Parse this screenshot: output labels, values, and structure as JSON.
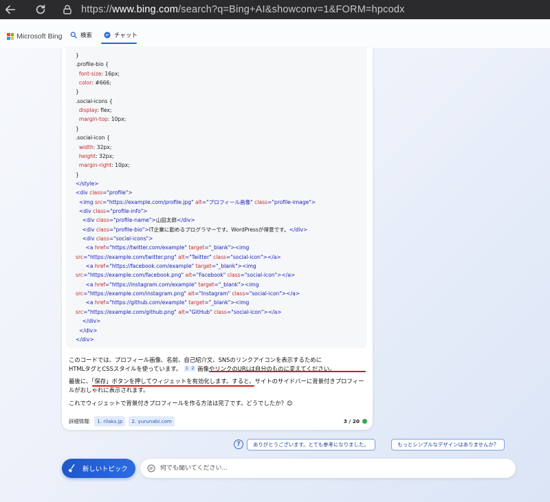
{
  "browser": {
    "url_scheme": "https://",
    "url_host": "www.bing.com",
    "url_path": "/search?q=Bing+AI&showconv=1&FORM=hpcodx"
  },
  "header": {
    "logo_text": "Microsoft Bing",
    "tab_search": "検索",
    "tab_chat": "チャット"
  },
  "code_lines": [
    [
      {
        "t": "}",
        "c": "t-txt"
      }
    ],
    [
      {
        "t": ".profile-bio {",
        "c": "t-txt"
      }
    ],
    [
      {
        "t": "  font-size",
        "c": "t-prop"
      },
      {
        "t": ": 16px;",
        "c": "t-txt"
      }
    ],
    [
      {
        "t": "  color",
        "c": "t-prop"
      },
      {
        "t": ": #666;",
        "c": "t-txt"
      }
    ],
    [
      {
        "t": "}",
        "c": "t-txt"
      }
    ],
    [
      {
        "t": ".social-icons {",
        "c": "t-txt"
      }
    ],
    [
      {
        "t": "  display",
        "c": "t-prop"
      },
      {
        "t": ": flex;",
        "c": "t-txt"
      }
    ],
    [
      {
        "t": "  margin-top",
        "c": "t-prop"
      },
      {
        "t": ": 10px;",
        "c": "t-txt"
      }
    ],
    [
      {
        "t": "}",
        "c": "t-txt"
      }
    ],
    [
      {
        "t": ".social-icon {",
        "c": "t-txt"
      }
    ],
    [
      {
        "t": "  width",
        "c": "t-prop"
      },
      {
        "t": ": 32px;",
        "c": "t-txt"
      }
    ],
    [
      {
        "t": "  height",
        "c": "t-prop"
      },
      {
        "t": ": 32px;",
        "c": "t-txt"
      }
    ],
    [
      {
        "t": "  margin-right",
        "c": "t-prop"
      },
      {
        "t": ": 10px;",
        "c": "t-txt"
      }
    ],
    [
      {
        "t": "}",
        "c": "t-txt"
      }
    ],
    [
      {
        "t": "</style>",
        "c": "t-tag"
      }
    ],
    [
      {
        "t": "<div ",
        "c": "t-tag"
      },
      {
        "t": "class",
        "c": "t-attr"
      },
      {
        "t": "=\"profile\">",
        "c": "t-val"
      }
    ],
    [
      {
        "t": "  <img ",
        "c": "t-tag"
      },
      {
        "t": "src",
        "c": "t-attr"
      },
      {
        "t": "=\"https://example.com/profile.jpg\" ",
        "c": "t-val"
      },
      {
        "t": "alt",
        "c": "t-attr"
      },
      {
        "t": "=\"プロフィール画像\" ",
        "c": "t-val"
      },
      {
        "t": "class",
        "c": "t-attr"
      },
      {
        "t": "=\"profile-image\">",
        "c": "t-val"
      }
    ],
    [
      {
        "t": "  <div ",
        "c": "t-tag"
      },
      {
        "t": "class",
        "c": "t-attr"
      },
      {
        "t": "=\"profile-info\">",
        "c": "t-val"
      }
    ],
    [
      {
        "t": "    <div ",
        "c": "t-tag"
      },
      {
        "t": "class",
        "c": "t-attr"
      },
      {
        "t": "=\"profile-name\">",
        "c": "t-val"
      },
      {
        "t": "山田太郎",
        "c": "t-txt"
      },
      {
        "t": "</div>",
        "c": "t-tag"
      }
    ],
    [
      {
        "t": "    <div ",
        "c": "t-tag"
      },
      {
        "t": "class",
        "c": "t-attr"
      },
      {
        "t": "=\"profile-bio\">",
        "c": "t-val"
      },
      {
        "t": "IT企業に勤めるプログラマーです。WordPressが得意です。",
        "c": "t-txt"
      },
      {
        "t": "</div>",
        "c": "t-tag"
      }
    ],
    [
      {
        "t": "    <div ",
        "c": "t-tag"
      },
      {
        "t": "class",
        "c": "t-attr"
      },
      {
        "t": "=\"social-icons\">",
        "c": "t-val"
      }
    ],
    [
      {
        "t": "      <a ",
        "c": "t-tag"
      },
      {
        "t": "href",
        "c": "t-attr"
      },
      {
        "t": "=\"https://twitter.com/example\" ",
        "c": "t-val"
      },
      {
        "t": "target",
        "c": "t-attr"
      },
      {
        "t": "=\"_blank\">",
        "c": "t-val"
      },
      {
        "t": "<img",
        "c": "t-tag"
      }
    ],
    [
      {
        "t": "src",
        "c": "t-attr"
      },
      {
        "t": "=\"https://example.com/twitter.png\" ",
        "c": "t-val"
      },
      {
        "t": "alt",
        "c": "t-attr"
      },
      {
        "t": "=\"Twitter\" ",
        "c": "t-val"
      },
      {
        "t": "class",
        "c": "t-attr"
      },
      {
        "t": "=\"social-icon\">",
        "c": "t-val"
      },
      {
        "t": "</a>",
        "c": "t-tag"
      }
    ],
    [
      {
        "t": "      <a ",
        "c": "t-tag"
      },
      {
        "t": "href",
        "c": "t-attr"
      },
      {
        "t": "=\"https://facebook.com/example\" ",
        "c": "t-val"
      },
      {
        "t": "target",
        "c": "t-attr"
      },
      {
        "t": "=\"_blank\">",
        "c": "t-val"
      },
      {
        "t": "<img",
        "c": "t-tag"
      }
    ],
    [
      {
        "t": "src",
        "c": "t-attr"
      },
      {
        "t": "=\"https://example.com/facebook.png\" ",
        "c": "t-val"
      },
      {
        "t": "alt",
        "c": "t-attr"
      },
      {
        "t": "=\"Facebook\" ",
        "c": "t-val"
      },
      {
        "t": "class",
        "c": "t-attr"
      },
      {
        "t": "=\"social-icon\">",
        "c": "t-val"
      },
      {
        "t": "</a>",
        "c": "t-tag"
      }
    ],
    [
      {
        "t": "      <a ",
        "c": "t-tag"
      },
      {
        "t": "href",
        "c": "t-attr"
      },
      {
        "t": "=\"https://instagram.com/example\" ",
        "c": "t-val"
      },
      {
        "t": "target",
        "c": "t-attr"
      },
      {
        "t": "=\"_blank\">",
        "c": "t-val"
      },
      {
        "t": "<img",
        "c": "t-tag"
      }
    ],
    [
      {
        "t": "src",
        "c": "t-attr"
      },
      {
        "t": "=\"https://example.com/instagram.png\" ",
        "c": "t-val"
      },
      {
        "t": "alt",
        "c": "t-attr"
      },
      {
        "t": "=\"Instagram\" ",
        "c": "t-val"
      },
      {
        "t": "class",
        "c": "t-attr"
      },
      {
        "t": "=\"social-icon\">",
        "c": "t-val"
      },
      {
        "t": "</a>",
        "c": "t-tag"
      }
    ],
    [
      {
        "t": "      <a ",
        "c": "t-tag"
      },
      {
        "t": "href",
        "c": "t-attr"
      },
      {
        "t": "=\"https://github.com/example\" ",
        "c": "t-val"
      },
      {
        "t": "target",
        "c": "t-attr"
      },
      {
        "t": "=\"_blank\">",
        "c": "t-val"
      },
      {
        "t": "<img",
        "c": "t-tag"
      }
    ],
    [
      {
        "t": "src",
        "c": "t-attr"
      },
      {
        "t": "=\"https://example.com/github.png\" ",
        "c": "t-val"
      },
      {
        "t": "alt",
        "c": "t-attr"
      },
      {
        "t": "=\"GitHub\" ",
        "c": "t-val"
      },
      {
        "t": "class",
        "c": "t-attr"
      },
      {
        "t": "=\"social-icon\">",
        "c": "t-val"
      },
      {
        "t": "</a>",
        "c": "t-tag"
      }
    ],
    [
      {
        "t": "    </div>",
        "c": "t-tag"
      }
    ],
    [
      {
        "t": "  </div>",
        "c": "t-tag"
      }
    ],
    [
      {
        "t": "</div>",
        "c": "t-tag"
      }
    ]
  ],
  "answer": {
    "p1_a": "このコードでは、プロフィール画像、名前、自己紹介文、SNSのリンクアイコンを表示するために",
    "p1_b": "HTMLタグとCSSスタイルを使っています。",
    "cite1": "1",
    "cite2": "2",
    "p1_c": " 画像やリンクのURLは自分のものに変えてください。",
    "p2": "最後に、「保存」ボタンを押してウィジェットを有効化します。すると、サイトのサイドバーに背景付きプロフィールがおしゃれに表示されます。",
    "p3": "これでウィジェットで背景付きプロフィールを作る方法は完了です。どうでしたか？😊"
  },
  "details": {
    "label": "詳細情報:",
    "links": [
      "1. rilaks.jp",
      "2. yurunabi.com"
    ],
    "page_count": "3 / 20"
  },
  "suggestions": {
    "help": "?",
    "items": [
      "ありがとうございます。とても参考になりました。",
      "もっとシンプルなデザインはありませんか？"
    ]
  },
  "input": {
    "new_topic_label": "新しいトピック",
    "placeholder": "何でも聞いてください..."
  },
  "colors": {
    "accent": "#2563d4",
    "highlight_underline": "#e01414",
    "status_dot": "#2fa84f"
  }
}
